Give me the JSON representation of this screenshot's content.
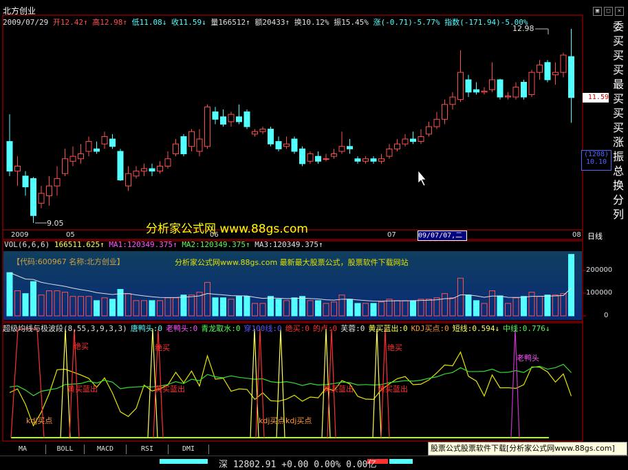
{
  "window": {
    "stock_title": "北方创业",
    "buttons": [
      "▣",
      "□",
      "✕"
    ]
  },
  "info_line": {
    "date": "2009/07/29",
    "open_label": "开",
    "open": "12.42",
    "high_label": "高",
    "high": "12.98",
    "low_label": "低",
    "low": "11.08",
    "close_label": "收",
    "close": "11.59",
    "volume_label": "量",
    "volume": "166512",
    "amount_label": "额",
    "amount": "20433",
    "turnover_label": "换",
    "turnover": "10.12%",
    "amplitude_label": "振",
    "amplitude": "15.45%",
    "change_label": "涨",
    "change": "(-0.71)-5.77%",
    "index_label": "指数",
    "index": "(-171.94)-5.00%"
  },
  "price_chart": {
    "high_mark": "12.98",
    "low_mark": "9.05",
    "price_tag": "11.59",
    "counter_top": "(1208)",
    "counter_bottom": "10.10",
    "date_axis": [
      "2009",
      "05",
      "06",
      "07",
      "08",
      "日线"
    ],
    "cursor_date": "09/07/07,二",
    "watermark": "分析家公式网 www.88gs.com",
    "axis_color_up": "#ff5050",
    "axis_color_down": "#54ffff"
  },
  "volume_panel": {
    "legend": {
      "title": "VOL(6,6,6)",
      "vol": "166511.625",
      "ma1": "MA1:120349.375",
      "ma2": "MA2:120349.375",
      "ma3": "MA3:120349.375"
    },
    "code_text": "【代码:600967 名称:北方创业】",
    "ad_text": "分析家公式网www.88gs.com 最新最大股票公式，股票软件下载网站",
    "y_ticks": [
      "200000",
      "100000",
      "0"
    ]
  },
  "indicator_panel": {
    "legend": [
      {
        "text": "超级均线与极波段(8,55,3,9,3,3)",
        "color": "#e0e0e0"
      },
      {
        "text": "唐鸭头:0",
        "color": "#54ffff"
      },
      {
        "text": "老鸭头:0",
        "color": "#ff54ff"
      },
      {
        "text": "青龙取水:0",
        "color": "#54ff54"
      },
      {
        "text": "穿100线:0",
        "color": "#5555ff"
      },
      {
        "text": "绝买:0",
        "color": "#ff3030"
      },
      {
        "text": "的卢:0",
        "color": "#ff3030"
      },
      {
        "text": "芙蓉:0",
        "color": "#e0e0e0"
      },
      {
        "text": "黄买蓝出:0",
        "color": "#ffff54"
      },
      {
        "text": "KDJ买点:0",
        "color": "#ff9933"
      },
      {
        "text": "短线:0.594↓",
        "color": "#ffff54"
      },
      {
        "text": "中线:0.776↓",
        "color": "#54ff54"
      }
    ],
    "labels": [
      "绝买",
      "绝买",
      "绝买",
      "黄买蓝出",
      "黄买蓝出",
      "黄买蓝出",
      "黄买蓝出",
      "kdj买点",
      "kdj买点",
      "kdj买点",
      "老鸭头"
    ]
  },
  "right_strip": [
    "委",
    "买",
    "买",
    "买",
    "最",
    "买",
    "买",
    "买",
    "涨",
    "振",
    "总",
    "换",
    "分",
    "列"
  ],
  "tabs": [
    "MA",
    "BOLL",
    "MACD",
    "RSI",
    "DMI"
  ],
  "ad_box": "股票公式股票软件下载[分析家公式网www.88gs.com]",
  "status": "深 12802.91 +0.00 0.00% 0.00亿",
  "chart_data": {
    "type": "candlestick",
    "title": "北方创业",
    "xlabel": "",
    "ylabel": "",
    "ylim": [
      9.05,
      12.98
    ],
    "x_ticks": [
      "2009",
      "05",
      "06",
      "07",
      "08"
    ],
    "candles": [
      {
        "o": 10.7,
        "c": 10.1,
        "h": 11.25,
        "l": 10.0
      },
      {
        "o": 10.1,
        "c": 10.2,
        "h": 10.4,
        "l": 9.8
      },
      {
        "o": 10.0,
        "c": 9.78,
        "h": 10.1,
        "l": 9.6
      },
      {
        "o": 9.95,
        "c": 9.2,
        "h": 9.98,
        "l": 9.05
      },
      {
        "o": 9.45,
        "c": 9.65,
        "h": 9.8,
        "l": 9.35
      },
      {
        "o": 9.6,
        "c": 9.8,
        "h": 10.0,
        "l": 9.4
      },
      {
        "o": 9.8,
        "c": 9.95,
        "h": 10.2,
        "l": 9.6
      },
      {
        "o": 10.05,
        "c": 10.35,
        "h": 10.55,
        "l": 10.0
      },
      {
        "o": 10.3,
        "c": 10.4,
        "h": 10.6,
        "l": 10.2
      },
      {
        "o": 10.35,
        "c": 10.45,
        "h": 10.65,
        "l": 10.25
      },
      {
        "o": 10.5,
        "c": 10.7,
        "h": 10.8,
        "l": 10.4
      },
      {
        "o": 10.55,
        "c": 10.5,
        "h": 10.7,
        "l": 10.45
      },
      {
        "o": 10.65,
        "c": 10.8,
        "h": 10.9,
        "l": 10.55
      },
      {
        "o": 10.75,
        "c": 10.6,
        "h": 10.85,
        "l": 10.55
      },
      {
        "o": 10.5,
        "c": 9.92,
        "h": 10.55,
        "l": 9.9
      },
      {
        "o": 9.8,
        "c": 10.05,
        "h": 10.2,
        "l": 9.7
      },
      {
        "o": 10.0,
        "c": 10.1,
        "h": 10.2,
        "l": 9.95
      },
      {
        "o": 10.1,
        "c": 10.15,
        "h": 10.25,
        "l": 10.0
      },
      {
        "o": 10.15,
        "c": 10.1,
        "h": 10.25,
        "l": 10.0
      },
      {
        "o": 10.1,
        "c": 10.2,
        "h": 10.3,
        "l": 10.05
      },
      {
        "o": 10.2,
        "c": 10.35,
        "h": 10.5,
        "l": 10.15
      },
      {
        "o": 10.45,
        "c": 10.65,
        "h": 10.75,
        "l": 10.4
      },
      {
        "o": 10.8,
        "c": 10.45,
        "h": 10.85,
        "l": 10.4
      },
      {
        "o": 10.6,
        "c": 10.9,
        "h": 10.95,
        "l": 10.5
      },
      {
        "o": 10.5,
        "c": 10.75,
        "h": 10.95,
        "l": 10.4
      },
      {
        "o": 10.6,
        "c": 11.4,
        "h": 11.45,
        "l": 10.55
      },
      {
        "o": 11.3,
        "c": 11.15,
        "h": 11.4,
        "l": 11.05
      },
      {
        "o": 11.2,
        "c": 11.05,
        "h": 11.35,
        "l": 11.0
      },
      {
        "o": 11.1,
        "c": 11.25,
        "h": 11.3,
        "l": 11.0
      },
      {
        "o": 11.2,
        "c": 11.1,
        "h": 11.45,
        "l": 11.05
      },
      {
        "o": 11.3,
        "c": 11.0,
        "h": 11.35,
        "l": 10.95
      },
      {
        "o": 10.85,
        "c": 10.9,
        "h": 10.95,
        "l": 10.8
      },
      {
        "o": 10.9,
        "c": 10.95,
        "h": 11.0,
        "l": 10.85
      },
      {
        "o": 10.95,
        "c": 10.65,
        "h": 11.0,
        "l": 10.6
      },
      {
        "o": 10.7,
        "c": 10.55,
        "h": 10.8,
        "l": 10.5
      },
      {
        "o": 10.6,
        "c": 10.65,
        "h": 10.8,
        "l": 10.55
      },
      {
        "o": 10.75,
        "c": 10.5,
        "h": 10.8,
        "l": 10.45
      },
      {
        "o": 10.55,
        "c": 10.25,
        "h": 10.6,
        "l": 10.2
      },
      {
        "o": 10.3,
        "c": 10.45,
        "h": 10.5,
        "l": 10.25
      },
      {
        "o": 10.4,
        "c": 10.3,
        "h": 10.5,
        "l": 10.25
      },
      {
        "o": 10.35,
        "c": 10.35,
        "h": 10.45,
        "l": 10.3
      },
      {
        "o": 10.4,
        "c": 10.45,
        "h": 10.55,
        "l": 10.35
      },
      {
        "o": 10.5,
        "c": 10.6,
        "h": 10.9,
        "l": 10.45
      },
      {
        "o": 10.6,
        "c": 10.55,
        "h": 10.75,
        "l": 10.45
      },
      {
        "o": 10.35,
        "c": 10.3,
        "h": 10.4,
        "l": 10.25
      },
      {
        "o": 10.3,
        "c": 10.35,
        "h": 10.4,
        "l": 10.25
      },
      {
        "o": 10.35,
        "c": 10.3,
        "h": 10.4,
        "l": 10.25
      },
      {
        "o": 10.3,
        "c": 10.35,
        "h": 10.45,
        "l": 10.25
      },
      {
        "o": 10.4,
        "c": 10.55,
        "h": 10.65,
        "l": 10.35
      },
      {
        "o": 10.55,
        "c": 10.65,
        "h": 10.75,
        "l": 10.5
      },
      {
        "o": 10.65,
        "c": 10.75,
        "h": 10.85,
        "l": 10.6
      },
      {
        "o": 10.75,
        "c": 10.7,
        "h": 10.9,
        "l": 10.65
      },
      {
        "o": 10.7,
        "c": 10.8,
        "h": 10.95,
        "l": 10.65
      },
      {
        "o": 10.85,
        "c": 11.0,
        "h": 11.1,
        "l": 10.8
      },
      {
        "o": 11.0,
        "c": 11.15,
        "h": 11.3,
        "l": 10.95
      },
      {
        "o": 11.15,
        "c": 11.45,
        "h": 11.55,
        "l": 11.05
      },
      {
        "o": 11.45,
        "c": 11.6,
        "h": 11.7,
        "l": 11.35
      },
      {
        "o": 11.55,
        "c": 12.1,
        "h": 12.55,
        "l": 11.5
      },
      {
        "o": 11.95,
        "c": 11.7,
        "h": 12.05,
        "l": 11.6
      },
      {
        "o": 11.75,
        "c": 11.7,
        "h": 11.9,
        "l": 11.65
      },
      {
        "o": 11.7,
        "c": 11.72,
        "h": 11.8,
        "l": 11.65
      },
      {
        "o": 11.75,
        "c": 11.95,
        "h": 12.3,
        "l": 11.7
      },
      {
        "o": 11.95,
        "c": 11.6,
        "h": 11.97,
        "l": 11.55
      },
      {
        "o": 11.6,
        "c": 11.62,
        "h": 11.7,
        "l": 11.55
      },
      {
        "o": 11.6,
        "c": 11.8,
        "h": 11.9,
        "l": 11.55
      },
      {
        "o": 11.9,
        "c": 11.6,
        "h": 11.95,
        "l": 11.55
      },
      {
        "o": 11.65,
        "c": 12.1,
        "h": 12.15,
        "l": 11.6
      },
      {
        "o": 12.1,
        "c": 12.25,
        "h": 12.35,
        "l": 11.95
      },
      {
        "o": 12.3,
        "c": 11.95,
        "h": 12.35,
        "l": 11.9
      },
      {
        "o": 12.05,
        "c": 12.1,
        "h": 12.3,
        "l": 11.85
      },
      {
        "o": 12.1,
        "c": 12.45,
        "h": 12.5,
        "l": 12.0
      },
      {
        "o": 12.42,
        "c": 11.59,
        "h": 12.98,
        "l": 11.08
      }
    ]
  }
}
